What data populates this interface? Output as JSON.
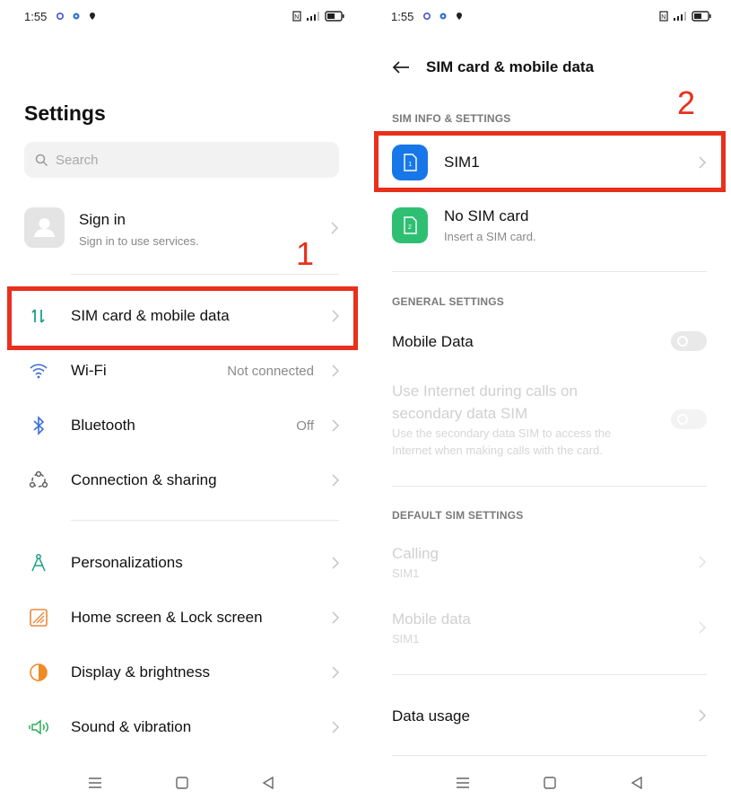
{
  "status": {
    "time": "1:55"
  },
  "left": {
    "title": "Settings",
    "search_placeholder": "Search",
    "signin": {
      "title": "Sign in",
      "subtitle": "Sign in to use services."
    },
    "rows": [
      {
        "label": "SIM card & mobile data",
        "value": "",
        "icon": "sim-data-arrows-icon"
      },
      {
        "label": "Wi-Fi",
        "value": "Not connected",
        "icon": "wifi-icon"
      },
      {
        "label": "Bluetooth",
        "value": "Off",
        "icon": "bluetooth-icon"
      },
      {
        "label": "Connection & sharing",
        "value": "",
        "icon": "connection-sharing-icon"
      },
      {
        "label": "Personalizations",
        "value": "",
        "icon": "personalization-icon"
      },
      {
        "label": "Home screen & Lock screen",
        "value": "",
        "icon": "home-lock-screen-icon"
      },
      {
        "label": "Display & brightness",
        "value": "",
        "icon": "display-brightness-icon"
      },
      {
        "label": "Sound & vibration",
        "value": "",
        "icon": "sound-vibration-icon"
      }
    ],
    "annotation": "1"
  },
  "right": {
    "title": "SIM card & mobile data",
    "sections": {
      "sim_info": "SIM INFO & SETTINGS",
      "general": "GENERAL SETTINGS",
      "default_sim": "DEFAULT SIM SETTINGS"
    },
    "sim1": {
      "label": "SIM1",
      "badge": "1"
    },
    "no_sim": {
      "label": "No SIM card",
      "subtitle": "Insert a SIM card.",
      "badge": "2"
    },
    "mobile_data_label": "Mobile Data",
    "use_internet": {
      "title": "Use Internet during calls on secondary data SIM",
      "subtitle": "Use the secondary data SIM to access the Internet when making calls with the card."
    },
    "calling": {
      "title": "Calling",
      "subtitle": "SIM1"
    },
    "mobile_data_default": {
      "title": "Mobile data",
      "subtitle": "SIM1"
    },
    "data_usage": "Data usage",
    "annotation": "2"
  },
  "colors": {
    "highlight": "#e8301c",
    "sim1_blue": "#1877e8",
    "sim2_green": "#2fbf73",
    "accent_teal": "#1aa08a"
  }
}
